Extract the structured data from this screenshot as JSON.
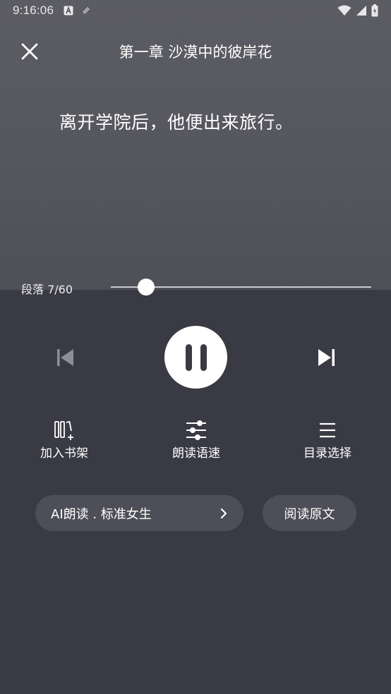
{
  "status_bar": {
    "time": "9:16:06",
    "notification_icons": [
      "a-square-icon",
      "pen-notification-icon"
    ],
    "system_icons": [
      "wifi-icon",
      "cellular-signal-icon",
      "battery-icon"
    ]
  },
  "header": {
    "chapter_title": "第一章 沙漠中的彼岸花",
    "close_icon": "close-icon"
  },
  "content": {
    "paragraph": "离开学院后，他便出来旅行。"
  },
  "progress": {
    "label": "段落 7/60",
    "current": 7,
    "total": 60
  },
  "controls": {
    "prev_icon": "skip-previous-icon",
    "play_state_icon": "pause-icon",
    "next_icon": "skip-next-icon"
  },
  "features": [
    {
      "label": "加入书架",
      "icon": "bookshelf-add-icon"
    },
    {
      "label": "朗读语速",
      "icon": "sliders-icon"
    },
    {
      "label": "目录选择",
      "icon": "menu-list-icon"
    }
  ],
  "voice": {
    "label": "AI朗读 . 标准女生",
    "chevron_icon": "chevron-right-icon"
  },
  "read_original": {
    "label": "阅读原文"
  },
  "colors": {
    "top_background": "#58585f",
    "bottom_background": "#3a3a45",
    "pill_background": "#4e4e58",
    "text": "#ffffff"
  }
}
